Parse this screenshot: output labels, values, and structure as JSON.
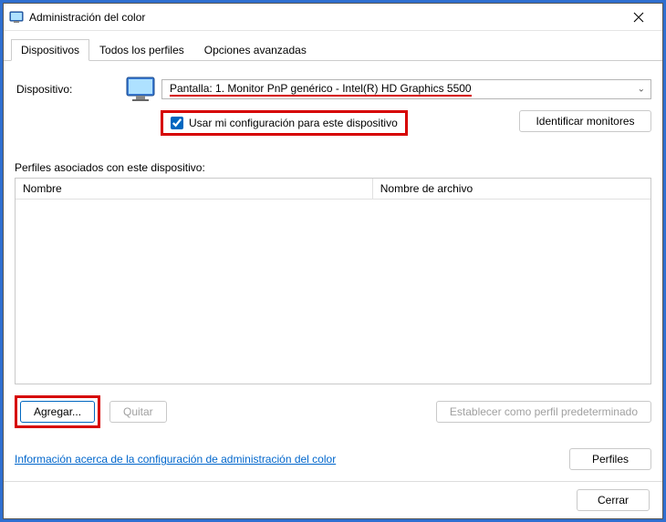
{
  "window": {
    "title": "Administración del color"
  },
  "tabs": {
    "devices": "Dispositivos",
    "all_profiles": "Todos los perfiles",
    "advanced": "Opciones avanzadas"
  },
  "device": {
    "label": "Dispositivo:",
    "selected": "Pantalla: 1. Monitor PnP genérico - Intel(R) HD Graphics 5500"
  },
  "checkbox": {
    "label": "Usar mi configuración para este dispositivo",
    "checked": true
  },
  "buttons": {
    "identify": "Identificar monitores",
    "add": "Agregar...",
    "remove": "Quitar",
    "set_default": "Establecer como perfil predeterminado",
    "profiles": "Perfiles",
    "close": "Cerrar"
  },
  "profiles_section": {
    "label": "Perfiles asociados con este dispositivo:",
    "col_name": "Nombre",
    "col_file": "Nombre de archivo"
  },
  "link": {
    "label": "Información acerca de la configuración de administración del color"
  }
}
